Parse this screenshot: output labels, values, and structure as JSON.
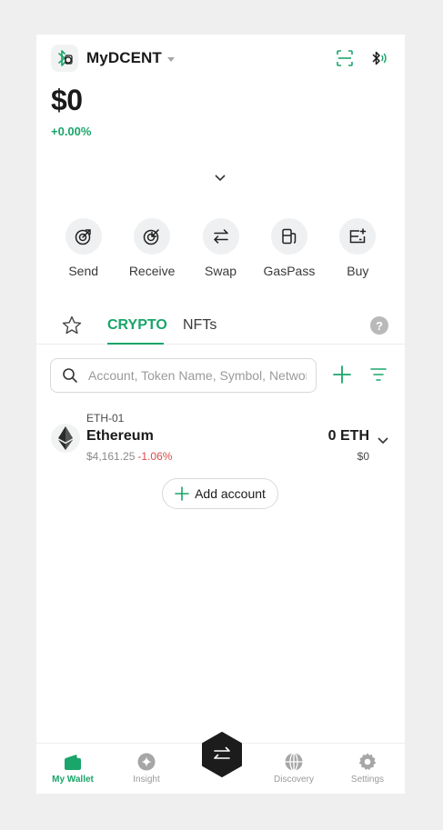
{
  "header": {
    "wallet_name": "MyDCENT"
  },
  "balance": {
    "total": "$0",
    "change": "+0.00%"
  },
  "actions": [
    {
      "label": "Send",
      "icon": "send-icon"
    },
    {
      "label": "Receive",
      "icon": "receive-icon"
    },
    {
      "label": "Swap",
      "icon": "swap-icon"
    },
    {
      "label": "GasPass",
      "icon": "gaspass-icon"
    },
    {
      "label": "Buy",
      "icon": "buy-icon"
    }
  ],
  "tabs": {
    "crypto": "CRYPTO",
    "nfts": "NFTs",
    "help": "?"
  },
  "search": {
    "placeholder": "Account, Token Name, Symbol, Network"
  },
  "accounts": [
    {
      "account_id": "ETH-01",
      "name": "Ethereum",
      "price": "$4,161.25",
      "price_change": "-1.06%",
      "amount": "0 ETH",
      "fiat": "$0"
    }
  ],
  "add_account_label": "Add account",
  "bottom_nav": {
    "wallet": "My Wallet",
    "insight": "Insight",
    "discovery": "Discovery",
    "settings": "Settings"
  },
  "colors": {
    "accent": "#1aa56a",
    "negative": "#d94b4b",
    "fab": "#1c1c1c"
  }
}
